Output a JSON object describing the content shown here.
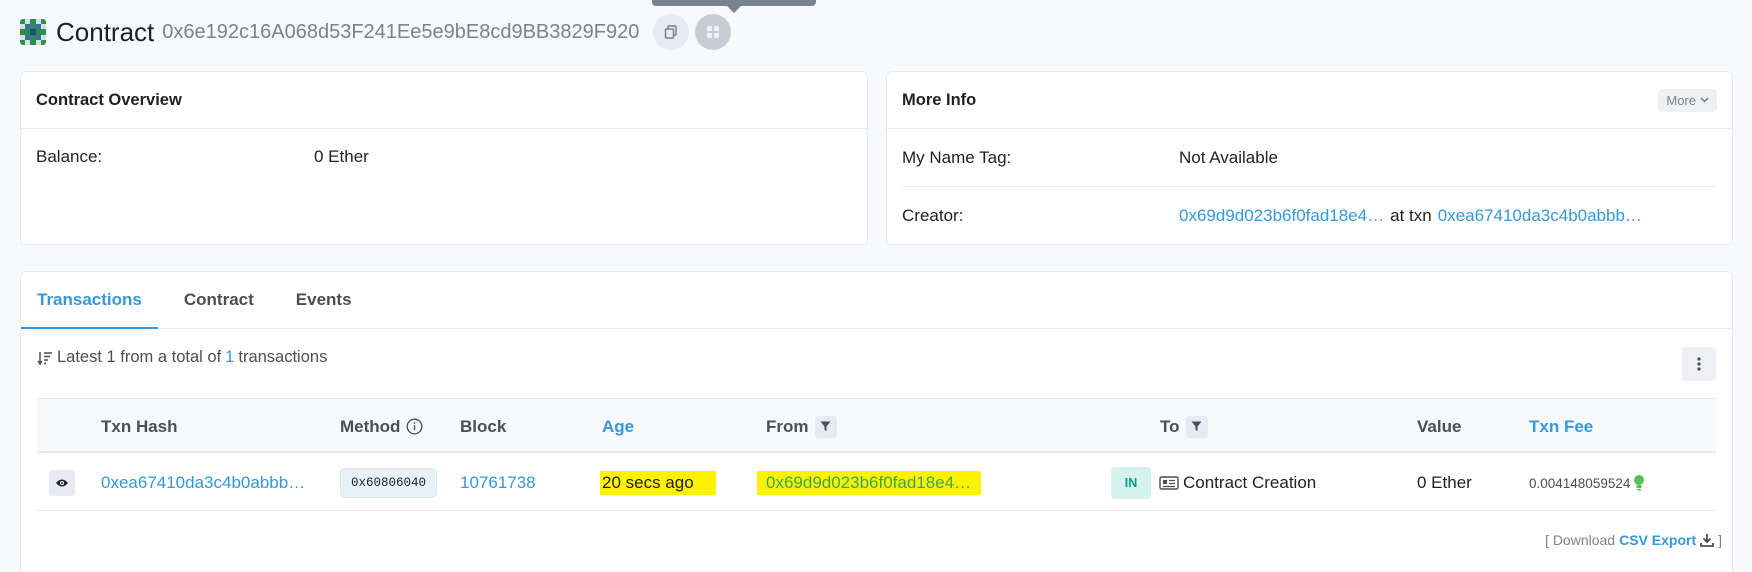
{
  "header": {
    "title": "Contract",
    "address": "0x6e192c16A068d53F241Ee5e9bE8cd9BB3829F920"
  },
  "overview": {
    "title": "Contract Overview",
    "balance_label": "Balance:",
    "balance_value": "0 Ether"
  },
  "more_info": {
    "title": "More Info",
    "more_label": "More",
    "name_tag_label": "My Name Tag:",
    "name_tag_value": "Not Available",
    "creator_label": "Creator:",
    "creator_address": "0x69d9d023b6f0fad18e4…",
    "at_txn_label": "at txn",
    "creator_txn": "0xea67410da3c4b0abbb…"
  },
  "tabs": [
    {
      "label": "Transactions",
      "active": true
    },
    {
      "label": "Contract",
      "active": false
    },
    {
      "label": "Events",
      "active": false
    }
  ],
  "summary": {
    "prefix": "Latest 1 from a total of",
    "count": "1",
    "suffix": "transactions"
  },
  "table": {
    "columns": {
      "txn_hash": "Txn Hash",
      "method": "Method",
      "block": "Block",
      "age": "Age",
      "from": "From",
      "to": "To",
      "value": "Value",
      "txn_fee": "Txn Fee"
    },
    "rows": [
      {
        "txn_hash": "0xea67410da3c4b0abbb…",
        "method": "0x60806040",
        "block": "10761738",
        "age": "20 secs ago",
        "from": "0x69d9d023b6f0fad18e4…",
        "direction": "IN",
        "to": "Contract Creation",
        "value": "0 Ether",
        "txn_fee": "0.004148059524"
      }
    ]
  },
  "csv": {
    "prefix": "[ Download",
    "link": "CSV Export",
    "suffix": "]"
  },
  "colors": {
    "accent": "#3498db",
    "highlight": "#fff200",
    "in_badge_bg": "#d5f2ec",
    "in_badge_text": "#00a186"
  }
}
